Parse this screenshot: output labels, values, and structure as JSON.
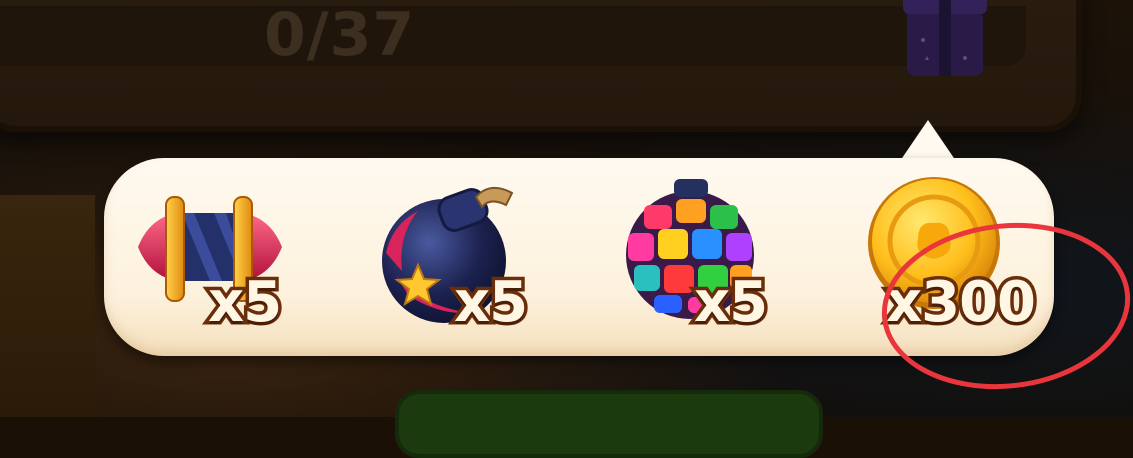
{
  "header": {
    "progress_text": "0/37"
  },
  "rewards": [
    {
      "item": "rocket-booster-icon",
      "quantity_label": "x5"
    },
    {
      "item": "bomb-booster-icon",
      "quantity_label": "x5"
    },
    {
      "item": "color-ball-booster-icon",
      "quantity_label": "x5"
    },
    {
      "item": "gold-coin-icon",
      "quantity_label": "x300"
    }
  ],
  "colors": {
    "tooltip_bg": "#fdf1dc",
    "quantity_text": "#fff6e4",
    "quantity_outline": "#6b2e0a",
    "highlight_circle": "#e8363c"
  }
}
